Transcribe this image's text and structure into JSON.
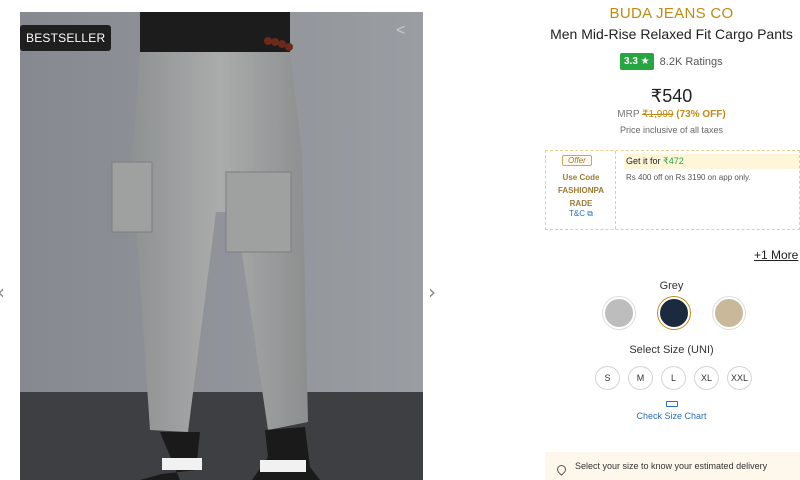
{
  "product": {
    "badge": "BESTSELLER",
    "brand": "BUDA JEANS CO",
    "title": "Men Mid-Rise Relaxed Fit Cargo Pants",
    "rating": "3.3 ★",
    "ratings_count": "8.2K Ratings",
    "price": "₹540",
    "mrp_label": "MRP",
    "mrp": "₹1,999",
    "discount": "(73% OFF)",
    "tax_note": "Price inclusive of all taxes"
  },
  "offer": {
    "tag": "Offer",
    "use_code_label": "Use Code",
    "code": "FASHIONPA RADE",
    "tnc": "T&C",
    "get_it_for_label": "Get it for",
    "get_it_for_price": "₹472",
    "description": "Rs 400 off on Rs 3190 on app only."
  },
  "more_offers": "+1 More",
  "colors": {
    "selected_label": "Grey",
    "swatches": [
      {
        "name": "grey",
        "hex": "#bdbdbd"
      },
      {
        "name": "navy",
        "hex": "#1c2a3f"
      },
      {
        "name": "khaki",
        "hex": "#c9b89a"
      }
    ]
  },
  "sizes": {
    "label": "Select Size (UNI)",
    "options": [
      "S",
      "M",
      "L",
      "XL",
      "XXL"
    ],
    "chart_link": "Check Size Chart"
  },
  "delivery": {
    "text": "Select your size to know your estimated delivery"
  },
  "icons": {
    "prev": "chevron-left-icon",
    "next": "chevron-right-icon",
    "share": "share-icon",
    "external": "external-link-icon",
    "ruler": "ruler-icon",
    "location": "location-pin-icon"
  },
  "theme": {
    "brand_color": "#c08a14",
    "rating_green": "#26a541",
    "link_blue": "#2a6fb8"
  }
}
